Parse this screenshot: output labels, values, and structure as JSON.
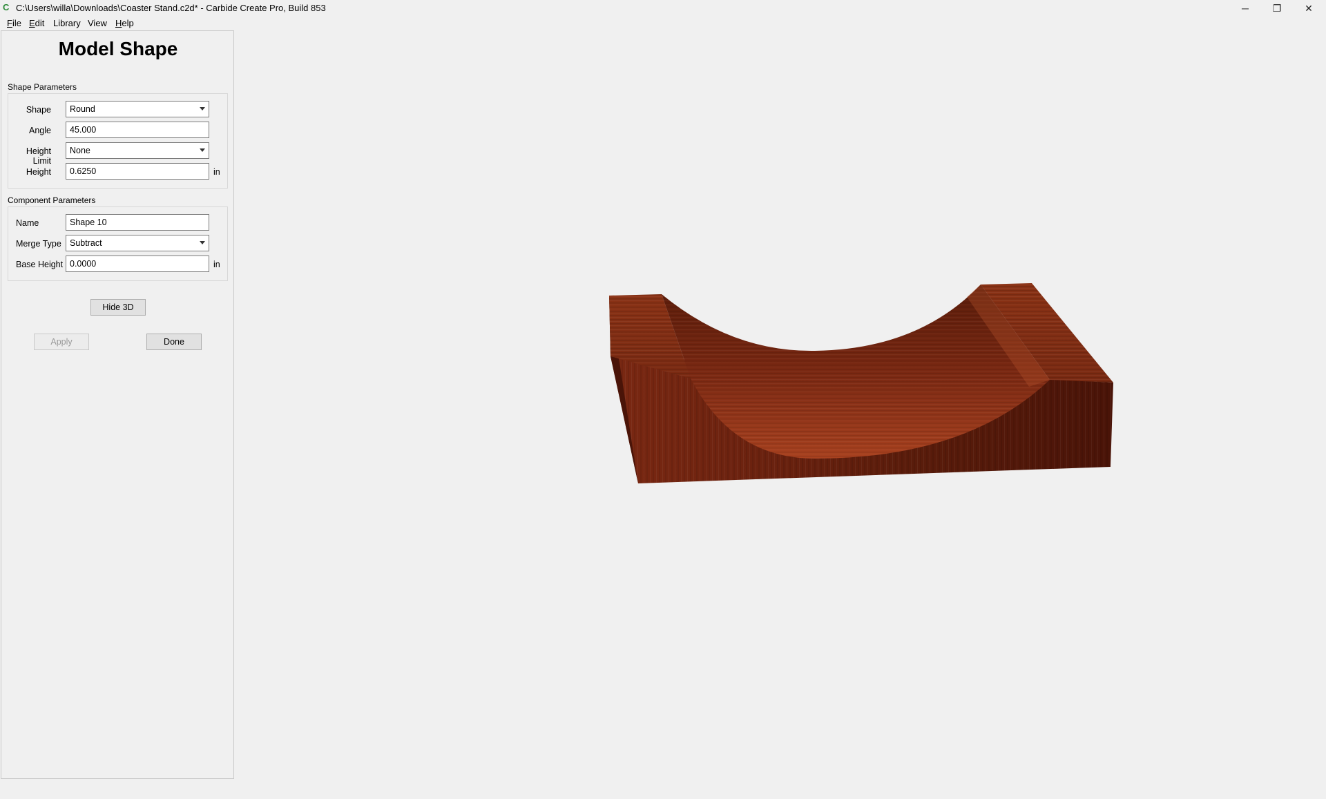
{
  "window": {
    "title": "C:\\Users\\willa\\Downloads\\Coaster Stand.c2d* - Carbide Create Pro, Build 853",
    "app_icon": "C",
    "minimize_glyph": "─",
    "restore_glyph": "❐",
    "close_glyph": "✕"
  },
  "menu": {
    "items": [
      {
        "ul": "F",
        "rest": "ile"
      },
      {
        "ul": "E",
        "rest": "dit"
      },
      {
        "ul": "",
        "rest": "Library"
      },
      {
        "ul": "",
        "rest": "View"
      },
      {
        "ul": "H",
        "rest": "elp"
      }
    ]
  },
  "panel": {
    "title": "Model Shape",
    "shape_params": {
      "label": "Shape Parameters",
      "shape_label": "Shape",
      "shape_value": "Round",
      "angle_label": "Angle",
      "angle_value": "45.000",
      "height_limit_label": "Height Limit",
      "height_limit_value": "None",
      "height_label": "Height",
      "height_value": "0.6250",
      "height_unit": "in"
    },
    "component_params": {
      "label": "Component Parameters",
      "name_label": "Name",
      "name_value": "Shape 10",
      "merge_type_label": "Merge Type",
      "merge_type_value": "Subtract",
      "base_height_label": "Base Height",
      "base_height_value": "0.0000",
      "base_height_unit": "in"
    },
    "hide3d_label": "Hide 3D",
    "apply_label": "Apply",
    "done_label": "Done"
  },
  "colors": {
    "wood_dark": "#4a1408",
    "wood_mid": "#7a2812",
    "wood_light": "#a8411f",
    "background": "#f0f0f0"
  }
}
